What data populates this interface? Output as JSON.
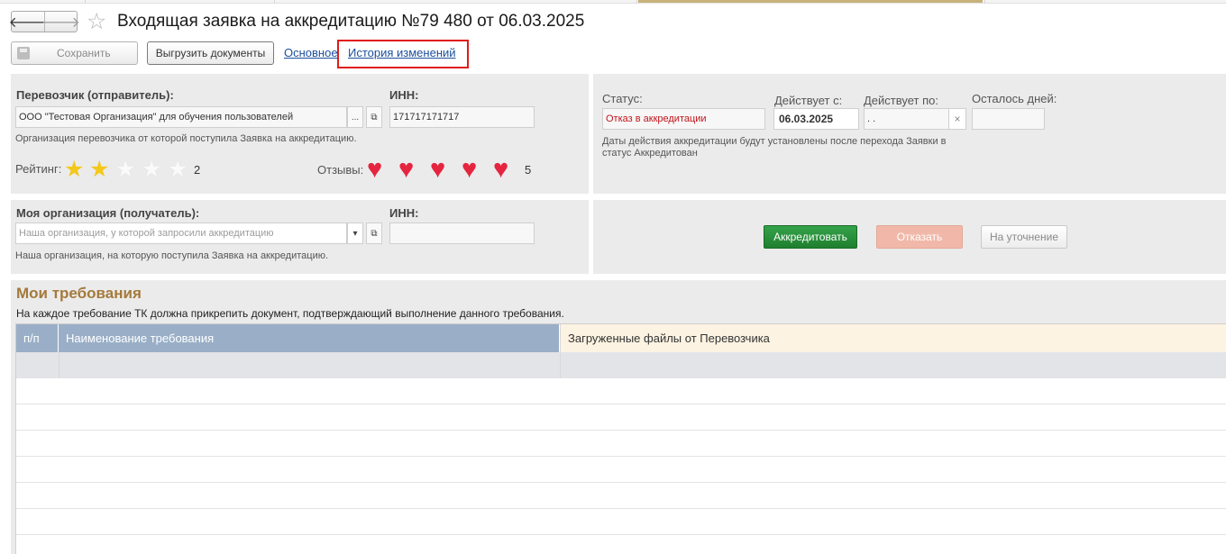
{
  "window": {
    "title": "Входящая заявка на аккредитацию №79 480 от 06.03.2025"
  },
  "nav": {
    "back_glyph": "🡐",
    "forward_glyph": "🡒",
    "favorite_glyph": "☆"
  },
  "toolbar": {
    "save_label": "Сохранить",
    "export_label": "Выгрузить документы",
    "tab_main": "Основное",
    "tab_history": "История изменений"
  },
  "carrier": {
    "label": "Перевозчик (отправитель):",
    "value": "ООО \"Тестовая Организация\" для обучения пользователей",
    "select_glyph": "...",
    "open_glyph": "⧉",
    "inn_label": "ИНН:",
    "inn_value": "171717171717",
    "hint": "Организация перевозчика от которой поступила Заявка на аккредитацию.",
    "rating_label": "Рейтинг:",
    "rating_value": 2,
    "rating_max": 5,
    "rating_text": "2",
    "star_glyph": "★",
    "reviews_label": "Отзывы:",
    "reviews_count": 5,
    "reviews_text": "5",
    "heart_glyph": "♥"
  },
  "status_panel": {
    "status_label": "Статус:",
    "status_value": "Отказ в аккредитации",
    "valid_from_label": "Действует с:",
    "valid_from_value": "06.03.2025",
    "valid_to_label": "Действует по:",
    "valid_to_value": " .  .",
    "clear_glyph": "×",
    "days_left_label": "Осталось дней:",
    "days_left_value": "",
    "hint_line1": "Даты действия аккредитации будут установлены после перехода Заявки в",
    "hint_line2": "статус Аккредитован"
  },
  "my_org": {
    "label": "Моя организация (получатель):",
    "placeholder": "Наша организация, у которой запросили аккредитацию",
    "dropdown_glyph": "▾",
    "open_glyph": "⧉",
    "inn_label": "ИНН:",
    "inn_value": "",
    "hint": "Наша организация, на которую поступила Заявка на аккредитацию."
  },
  "actions": {
    "accredit": "Аккредитовать",
    "reject": "Отказать",
    "clarify": "На уточнение"
  },
  "requirements": {
    "title": "Мои требования",
    "description": "На каждое требование ТК должна прикрепить документ, подтверждающий выполнение данного требования.",
    "columns": [
      "п/п",
      "Наименование требования",
      "Загруженные файлы от Перевозчика"
    ],
    "rows": []
  },
  "colors": {
    "panel_bg": "#ebebeb",
    "link": "#1c4f9c",
    "highlight_box": "#e01b1b",
    "accredit_green": "#2a9440",
    "status_red": "#c0151a",
    "section_title": "#a47a3b",
    "table_header": "#9aafc7"
  }
}
